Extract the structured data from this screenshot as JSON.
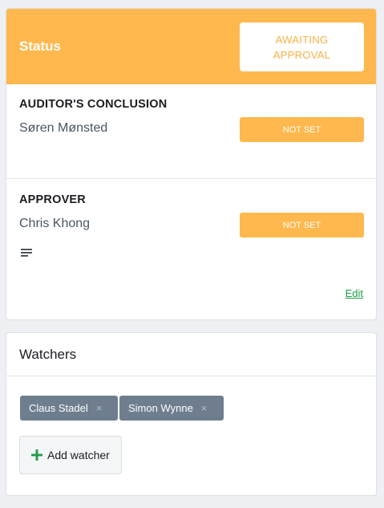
{
  "status": {
    "title": "Status",
    "button_label": "AWAITING APPROVAL"
  },
  "auditor": {
    "section_title": "AUDITOR'S CONCLUSION",
    "name": "Søren Mønsted",
    "badge": "NOT SET"
  },
  "approver": {
    "section_title": "APPROVER",
    "name": "Chris Khong",
    "badge": "NOT SET",
    "notes_icon": "lines-icon",
    "edit_label": "Edit"
  },
  "watchers": {
    "title": "Watchers",
    "items": [
      {
        "label": "Claus Stadel"
      },
      {
        "label": "Simon Wynne"
      }
    ],
    "remove_icon": "×",
    "add_label": "Add watcher",
    "add_icon": "plus-icon"
  },
  "colors": {
    "accent": "#ffb84d",
    "link": "#1e9c4a",
    "tag": "#6e7e8e"
  }
}
